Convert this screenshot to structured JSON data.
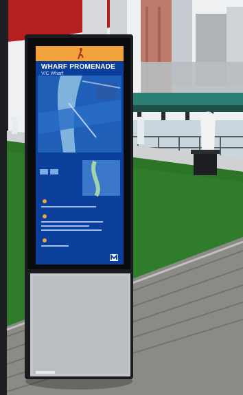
{
  "photo": {
    "kiosk": {
      "title": "WHARF PROMENADE",
      "subtitle": "V/C Wharf",
      "header_bar_color": "#f2a23a",
      "screen_color": "#0b3f9c",
      "icons": [
        "walking-person-icon",
        "map-pin-icon",
        "info-icon",
        "logo-icon"
      ]
    },
    "scene_colors": {
      "sky": "#f1f2f4",
      "grass": "#2f7d2b",
      "boardwalk": "#8c8a86",
      "concrete": "#c8cacb",
      "kiosk_frame": "#1b1c1f",
      "kiosk_panel": "#bfc2c6",
      "water": "#c9d6de"
    }
  }
}
